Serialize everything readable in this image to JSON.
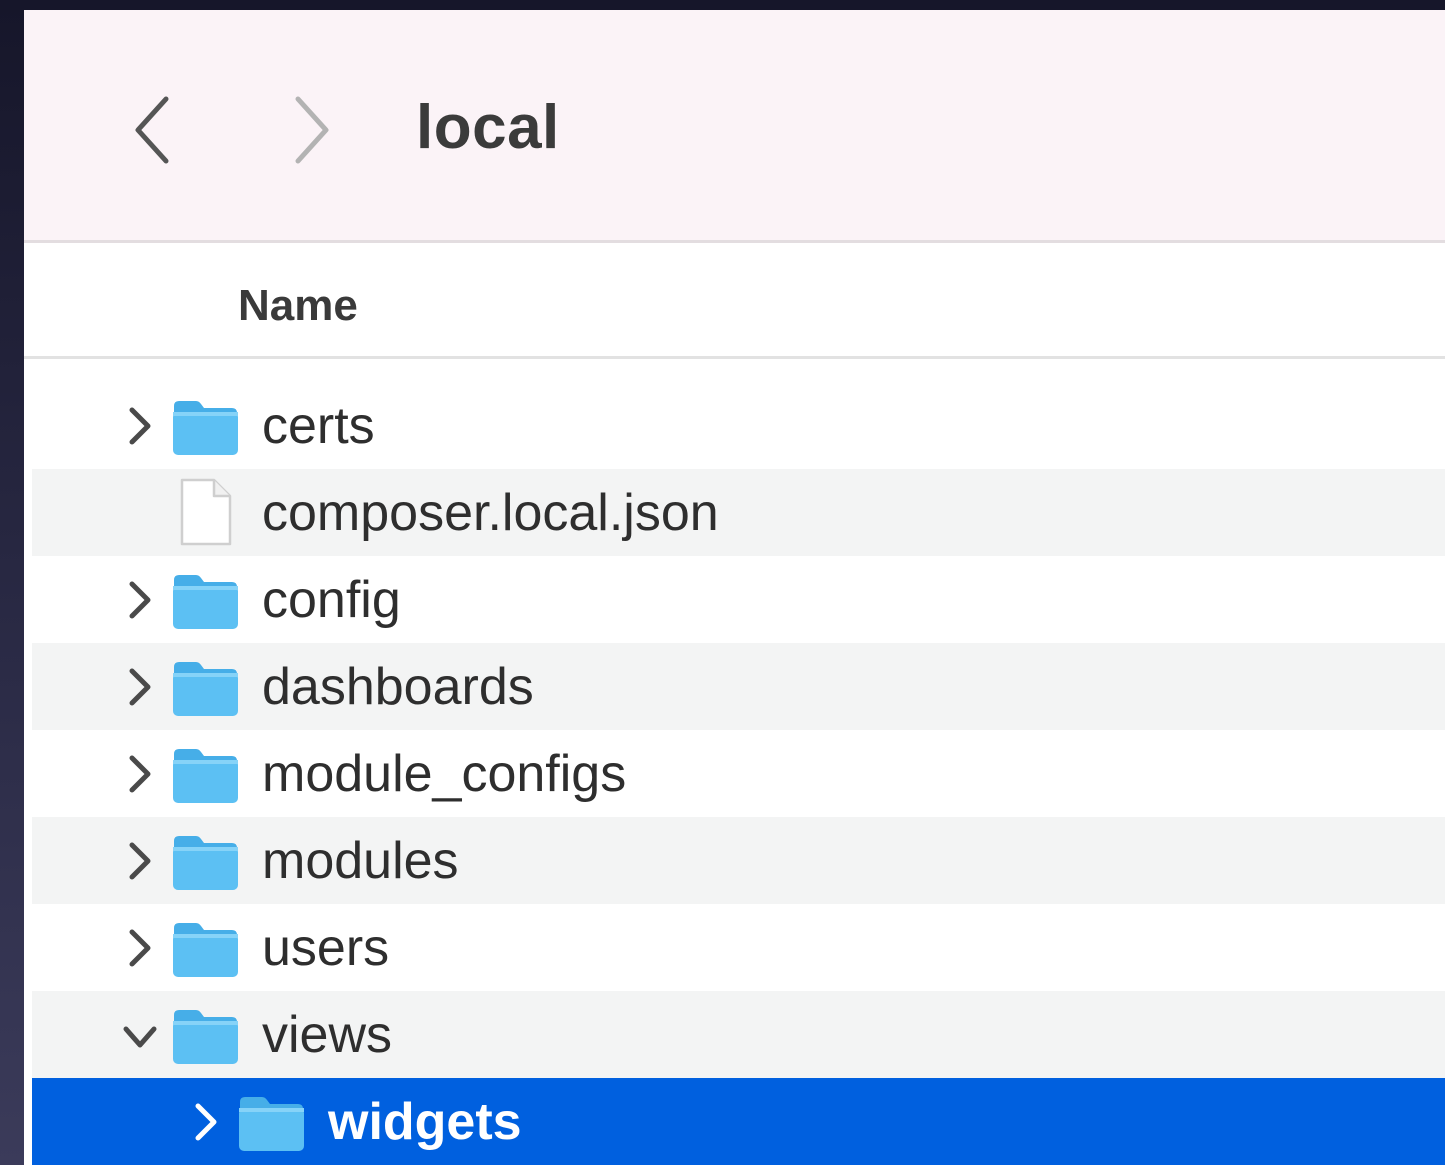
{
  "window": {
    "title": "local"
  },
  "toolbar": {
    "back_icon": "chevron-left-icon",
    "forward_icon": "chevron-right-icon"
  },
  "columns": {
    "name": "Name"
  },
  "colors": {
    "selection": "#0060df",
    "folder": "#5cc0f3",
    "folder_tab": "#46aee8"
  },
  "items": [
    {
      "name": "certs",
      "type": "folder",
      "expanded": false,
      "depth": 0
    },
    {
      "name": "composer.local.json",
      "type": "file",
      "depth": 0
    },
    {
      "name": "config",
      "type": "folder",
      "expanded": false,
      "depth": 0
    },
    {
      "name": "dashboards",
      "type": "folder",
      "expanded": false,
      "depth": 0
    },
    {
      "name": "module_configs",
      "type": "folder",
      "expanded": false,
      "depth": 0
    },
    {
      "name": "modules",
      "type": "folder",
      "expanded": false,
      "depth": 0
    },
    {
      "name": "users",
      "type": "folder",
      "expanded": false,
      "depth": 0
    },
    {
      "name": "views",
      "type": "folder",
      "expanded": true,
      "depth": 0
    },
    {
      "name": "widgets",
      "type": "folder",
      "expanded": false,
      "depth": 1,
      "selected": true
    }
  ]
}
